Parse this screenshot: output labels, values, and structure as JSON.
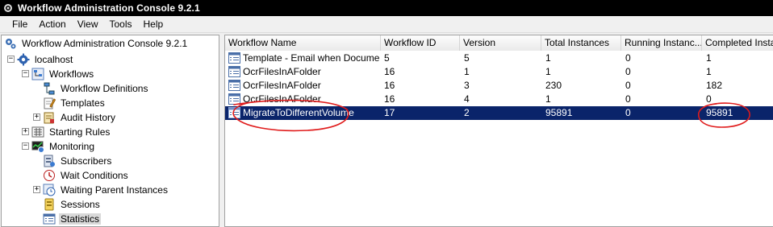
{
  "window": {
    "title": "Workflow Administration Console 9.2.1"
  },
  "menu": [
    "File",
    "Action",
    "View",
    "Tools",
    "Help"
  ],
  "tree": {
    "root": "Workflow Administration Console 9.2.1",
    "host": "localhost",
    "workflows": "Workflows",
    "workflow_definitions": "Workflow Definitions",
    "templates": "Templates",
    "audit_history": "Audit History",
    "starting_rules": "Starting Rules",
    "monitoring": "Monitoring",
    "subscribers": "Subscribers",
    "wait_conditions": "Wait Conditions",
    "waiting_parent_instances": "Waiting Parent Instances",
    "sessions": "Sessions",
    "statistics": "Statistics"
  },
  "table": {
    "columns": [
      "Workflow Name",
      "Workflow ID",
      "Version",
      "Total Instances",
      "Running Instanc...",
      "Completed Insta..."
    ],
    "rows": [
      {
        "name": "Template - Email when Document...",
        "id": "5",
        "version": "5",
        "total": "1",
        "running": "0",
        "completed": "1"
      },
      {
        "name": "OcrFilesInAFolder",
        "id": "16",
        "version": "1",
        "total": "1",
        "running": "0",
        "completed": "1"
      },
      {
        "name": "OcrFilesInAFolder",
        "id": "16",
        "version": "3",
        "total": "230",
        "running": "0",
        "completed": "182"
      },
      {
        "name": "OcrFilesInAFolder",
        "id": "16",
        "version": "4",
        "total": "1",
        "running": "0",
        "completed": "0"
      },
      {
        "name": "MigrateToDifferentVolume",
        "id": "17",
        "version": "2",
        "total": "95891",
        "running": "0",
        "completed": "95891"
      }
    ]
  },
  "colors": {
    "selection": "#0a246a",
    "annotation": "#e01b1b"
  }
}
